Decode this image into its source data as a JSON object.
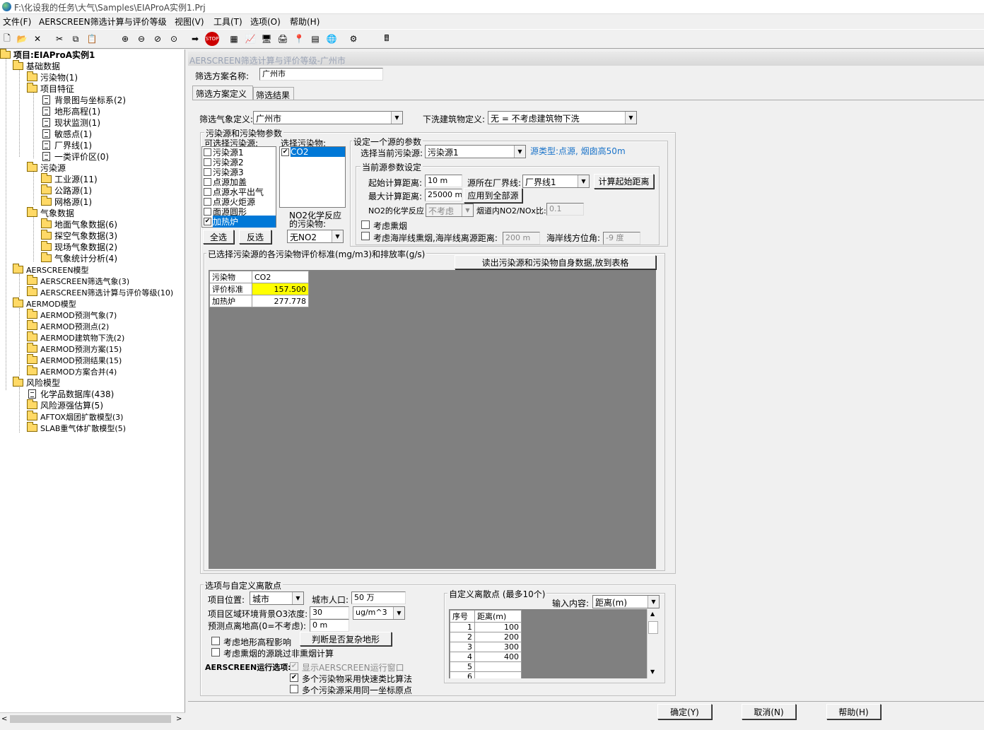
{
  "window": {
    "title": "F:\\化设我的任务\\大气\\Samples\\EIAProA实例1.Prj"
  },
  "menu": [
    "文件(F)",
    "AERSCREEN筛选计算与评价等级",
    "视图(V)",
    "工具(T)",
    "选项(O)",
    "帮助(H)"
  ],
  "tree": {
    "root": "项目:EIAProA实例1",
    "basic": "基础数据",
    "pollutant": "污染物(1)",
    "proj_feature": "项目特征",
    "bg_map": "背景图与坐标系(2)",
    "terrain": "地形高程(1)",
    "monitor": "现状监测(1)",
    "sensitive": "敏感点(1)",
    "boundary": "厂界线(1)",
    "zone": "一类评价区(0)",
    "sources": "污染源",
    "industrial": "工业源(11)",
    "road": "公路源(1)",
    "grid_src": "网格源(1)",
    "met": "气象数据",
    "surface_met": "地面气象数据(6)",
    "upper_met": "探空气象数据(3)",
    "site_met": "现场气象数据(2)",
    "met_stats": "气象统计分析(4)",
    "aerscreen_model": "AERSCREEN模型",
    "aerscreen_met": "AERSCREEN筛选气象(3)",
    "aerscreen_calc": "AERSCREEN筛选计算与评价等级(10)",
    "aermod_model": "AERMOD模型",
    "aermod_met": "AERMOD预测气象(7)",
    "aermod_pts": "AERMOD预测点(2)",
    "aermod_bldg": "AERMOD建筑物下洗(2)",
    "aermod_plan": "AERMOD预测方案(15)",
    "aermod_result": "AERMOD预测结果(15)",
    "aermod_merge": "AERMOD方案合并(4)",
    "risk_model": "风险模型",
    "chem_db": "化学品数据库(438)",
    "risk_src": "风险源强估算(5)",
    "aftox": "AFTOX烟团扩散模型(3)",
    "slab": "SLAB重气体扩散模型(5)"
  },
  "panel": {
    "title": "AERSCREEN筛选计算与评价等级-广州市",
    "plan_name_label": "筛选方案名称:",
    "plan_name": "广州市",
    "tab_def": "筛选方案定义",
    "tab_result": "筛选结果",
    "met_label": "筛选气象定义:",
    "met_value": "广州市",
    "downwash_label": "下洗建筑物定义:",
    "downwash_value": "无 = 不考虑建筑物下洗",
    "src_group_title": "污染源和污染物参数",
    "avail_src_label": "可选择污染源:",
    "sel_pol_label": "选择污染物:",
    "sources": [
      "污染源1",
      "污染源2",
      "污染源3",
      "点源加盖",
      "点源水平出气",
      "点源火炬源",
      "面源圆形",
      "加热炉"
    ],
    "pollutants": [
      "CO2"
    ],
    "select_all": "全选",
    "invert": "反选",
    "no2_label_1": "NO2化学反应",
    "no2_label_2": "的污染物:",
    "no2_value": "无NO2",
    "one_src_title": "设定一个源的参数",
    "cur_src_label": "选择当前污染源:",
    "cur_src_value": "污染源1",
    "src_type_info": "源类型:点源, 烟囱高50m",
    "cur_param_title": "当前源参数设定",
    "start_dist_label": "起始计算距离:",
    "start_dist": "10 m",
    "boundary_label": "源所在厂界线:",
    "boundary_value": "厂界线1",
    "calc_start_btn": "计算起始距离",
    "max_dist_label": "最大计算距离:",
    "max_dist": "25000 m",
    "apply_all_btn": "应用到全部源",
    "no2_chem_label": "NO2的化学反应",
    "no2_chem_value": "不考虑",
    "stack_ratio_label": "烟道内NO2/NOx比:",
    "stack_ratio": "0.1",
    "fumigation_label": "考虑熏烟",
    "shoreline_label": "考虑海岸线熏烟,海岸线离源距离:",
    "shoreline_dist": "200 m",
    "shoreline_dir_label": "海岸线方位角:",
    "shoreline_dir": "-9 度",
    "std_title": "已选择污染源的各污染物评价标准(mg/m3)和排放率(g/s)",
    "read_btn": "读出污染源和污染物自身数据,放到表格",
    "grid": {
      "header": [
        "污染物",
        "CO2"
      ],
      "rows": [
        [
          "评价标准",
          "157.500"
        ],
        [
          "加热炉",
          "277.778"
        ]
      ]
    },
    "opt_title": "选项与自定义离散点",
    "location_label": "项目位置:",
    "location_value": "城市",
    "population_label": "城市人口:",
    "population": "50 万",
    "o3_label": "项目区域环境背景O3浓度:",
    "o3_value": "30",
    "o3_unit": "ug/m^3",
    "height_label": "预测点离地高(0=不考虑):",
    "height_value": "0 m",
    "terrain_chk": "考虑地形高程影响",
    "complex_btn": "判断是否复杂地形",
    "fumigation_skip_chk": "考虑熏烟的源跳过非熏烟计算",
    "run_opt_label": "AERSCREEN运行选项:",
    "show_window_chk": "显示AERSCREEN运行窗口",
    "fast_chk": "多个污染物采用快速类比算法",
    "same_origin_chk": "多个污染源采用同一坐标原点",
    "custom_title": "自定义离散点 (最多10个)",
    "input_label": "输入内容:",
    "input_value": "距离(m)",
    "pts_header": [
      "序号",
      "距离(m)"
    ],
    "pts": [
      [
        "1",
        "100"
      ],
      [
        "2",
        "200"
      ],
      [
        "3",
        "300"
      ],
      [
        "4",
        "400"
      ],
      [
        "5",
        ""
      ],
      [
        "6",
        ""
      ]
    ]
  },
  "buttons": {
    "ok": "确定(Y)",
    "cancel": "取消(N)",
    "help": "帮助(H)"
  },
  "colors": {
    "highlight": "#ffff00",
    "selection": "#0078d7",
    "info": "#1a73c9",
    "grid_bg": "#808080"
  }
}
